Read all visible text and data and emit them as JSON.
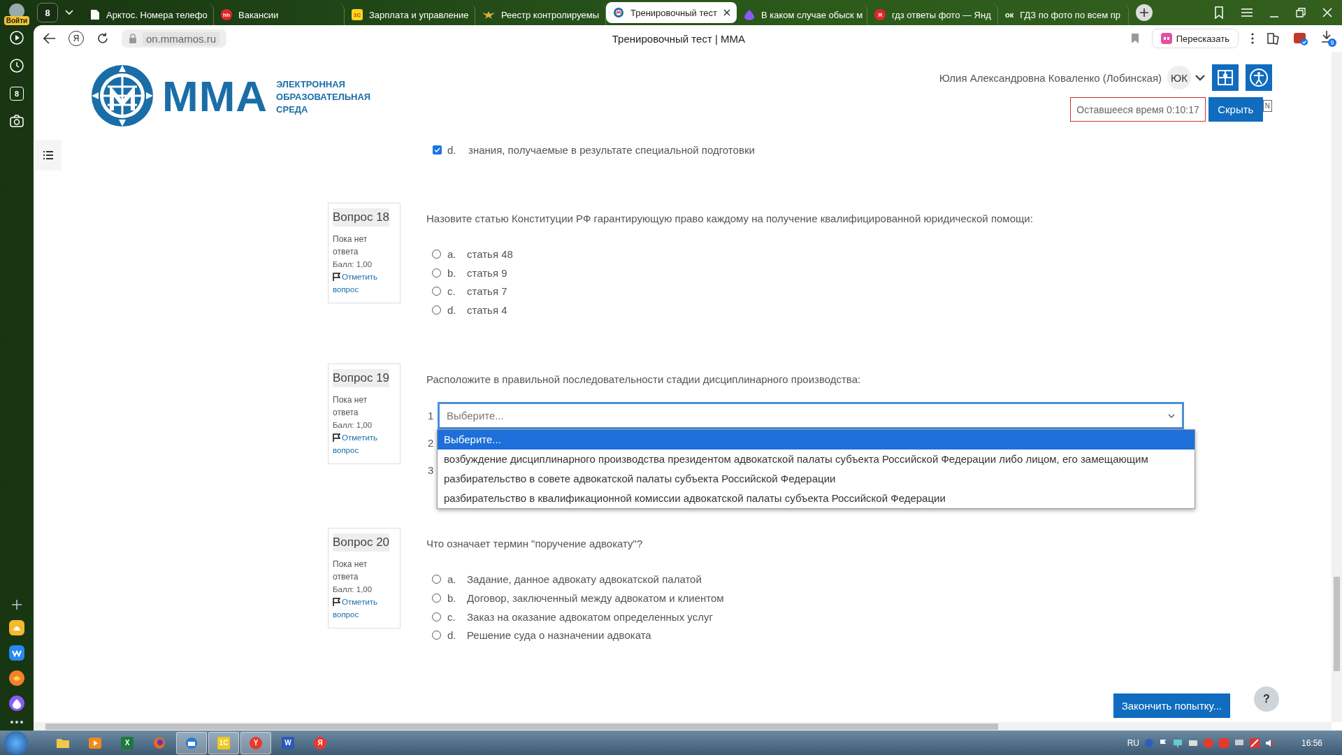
{
  "browser": {
    "profile_label": "Войти",
    "tab_counter": "8",
    "tabs": [
      {
        "kind": "doc",
        "title": "Арктос. Номера телефо",
        "selected": false
      },
      {
        "kind": "badge",
        "icon_text": "hh",
        "title": "Вакансии",
        "selected": false
      },
      {
        "kind": "square",
        "icon_text": "1С",
        "title": "Зарплата и управление",
        "selected": false
      },
      {
        "kind": "emblem",
        "title": "Реестр контролируемы",
        "selected": false
      },
      {
        "kind": "logo",
        "title": "Тренировочный тест",
        "selected": true
      },
      {
        "kind": "drop",
        "title": "В каком случае обыск м",
        "selected": false
      },
      {
        "kind": "badge",
        "icon_text": "Я",
        "title": "гдз ответы фото — Янд",
        "selected": false
      },
      {
        "kind": "plain",
        "icon_text": "ок",
        "title": "ГДЗ по фото по всем пр",
        "selected": false
      }
    ],
    "home_button": "Я",
    "address": "on.mmamos.ru",
    "page_title": "Тренировочный тест | ММА",
    "retell_button": "Пересказать",
    "downloads_count": "9",
    "sidebar_counter": "8"
  },
  "header": {
    "logo_title": "ММА",
    "logo_subtitle": "ЭЛЕКТРОННАЯ ОБРАЗОВАТЕЛЬНАЯ СРЕДА",
    "user_name": "Юлия Александровна Коваленко (Лобинская)",
    "user_initials": "ЮК",
    "timer": "Оставшееся время 0:10:17",
    "hide_button": "Скрыть",
    "language": "N"
  },
  "previous_answer": {
    "letter": "d.",
    "text": "знания, получаемые в результате специальной подготовки",
    "checked": true
  },
  "questions": [
    {
      "kind": "multichoice",
      "number_label": "Вопрос 18",
      "status": "Пока нет ответа",
      "grade": "Балл: 1,00",
      "flag_link": "Отметить вопрос",
      "text": "Назовите статью Конституции РФ гарантирующую право каждому на получение квалифицированной юридической помощи:",
      "options": [
        {
          "letter": "a.",
          "text": "статья 48",
          "selected": false
        },
        {
          "letter": "b.",
          "text": "статья 9",
          "selected": false
        },
        {
          "letter": "c.",
          "text": "статья 7",
          "selected": false
        },
        {
          "letter": "d.",
          "text": "статья 4",
          "selected": false
        }
      ]
    },
    {
      "kind": "ordering",
      "number_label": "Вопрос 19",
      "status": "Пока нет ответа",
      "grade": "Балл: 1,00",
      "flag_link": "Отметить вопрос",
      "text": "Расположите в правильной последовательности стадии дисциплинарного производства:",
      "rows": [
        {
          "number": "1",
          "value": "Выберите...",
          "open": true
        },
        {
          "number": "2"
        },
        {
          "number": "3"
        }
      ],
      "dropdown": [
        {
          "text": "Выберите...",
          "selected": true
        },
        {
          "text": "возбуждение дисциплинарного производства президентом адвокатской палаты субъекта Российской Федерации либо лицом, его замещающим",
          "selected": false
        },
        {
          "text": "разбирательство в совете адвокатской палаты субъекта Российской Федерации",
          "selected": false
        },
        {
          "text": "разбирательство в квалификационной комиссии адвокатской палаты субъекта Российской Федерации",
          "selected": false
        }
      ]
    },
    {
      "kind": "multichoice",
      "number_label": "Вопрос 20",
      "status": "Пока нет ответа",
      "grade": "Балл: 1,00",
      "flag_link": "Отметить вопрос",
      "text": "Что означает термин \"поручение адвокату\"?",
      "options": [
        {
          "letter": "a.",
          "text": "Задание, данное адвокату адвокатской палатой",
          "selected": false
        },
        {
          "letter": "b.",
          "text": "Договор, заключенный между адвокатом и клиентом",
          "selected": false
        },
        {
          "letter": "c.",
          "text": "Заказ на оказание адвокатом определенных услуг",
          "selected": false
        },
        {
          "letter": "d.",
          "text": "Решение суда о назначении адвоката",
          "selected": false
        }
      ]
    }
  ],
  "finish_button": "Закончить попытку...",
  "help_button": "?",
  "taskbar": {
    "apps": [
      {
        "kind": "folder",
        "active": false
      },
      {
        "kind": "player",
        "active": false
      },
      {
        "kind": "tile",
        "icon_text": "X",
        "color": "#1d7a3c",
        "active": false
      },
      {
        "kind": "globe",
        "active": false
      },
      {
        "kind": "bird",
        "active": true
      },
      {
        "kind": "tile",
        "icon_text": "1С",
        "color": "#f2c81a",
        "active": true
      },
      {
        "kind": "round",
        "icon_text": "Y",
        "color": "#e8392c",
        "active": true
      },
      {
        "kind": "tile",
        "icon_text": "W",
        "color": "#2b5bb5",
        "active": false
      },
      {
        "kind": "round",
        "icon_text": "Я",
        "color": "#e8392c",
        "active": false
      }
    ],
    "language": "RU",
    "clock": "16:56"
  }
}
